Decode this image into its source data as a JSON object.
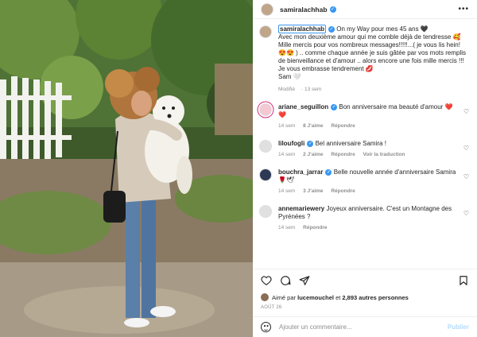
{
  "post": {
    "username": "samiralachhab",
    "more_label": "•••"
  },
  "caption": {
    "author": "samiralachhab",
    "lines": [
      "On my Way pour mes 45 ans 🖤",
      "Avec mon deuxième amour qui me comble déjà de tendresse 🥰",
      "Mille mercis pour vos nombreux messages!!!!!...( je vous lis hein! 😍😍 ) .. comme chaque année je suis gâtée par vos mots remplis de bienveillance et d'amour .. alors encore une fois mille mercis !!!",
      "Je vous embrasse tendrement 💋",
      "Sam 🤍"
    ],
    "edited": "Modifié",
    "time": "13 sem"
  },
  "comments": [
    {
      "username": "ariane_seguillon",
      "text": "Bon anniversaire ma beauté d'amour ❤️❤️",
      "time": "14 sem",
      "likes": "8 J'aime",
      "action": "Répondre"
    },
    {
      "username": "liloufogli",
      "text": "Bel anniversaire Samira !",
      "time": "14 sem",
      "likes": "2 J'aime",
      "action": "Répondre",
      "extra": "Voir la traduction"
    },
    {
      "username": "bouchra_jarrar",
      "text": "Belle nouvelle année d'anniversaire Samira 🌹🕊",
      "time": "14 sem",
      "likes": "3 J'aime",
      "action": "Répondre"
    },
    {
      "username": "annemariewery",
      "text": "Joyeux anniversaire. C'est un Montagne des Pyrénées ?",
      "time": "14 sem",
      "action": "Répondre"
    }
  ],
  "likes": {
    "prefix": "Aimé par",
    "user": "lucemouchel",
    "connector": "et",
    "others": "2,893 autres personnes"
  },
  "date": "AOÛT 26",
  "add_comment": {
    "placeholder": "Ajouter un commentaire...",
    "post_label": "Publier"
  },
  "colors": {
    "verified": "#3897f0",
    "publish_disabled": "#b3dbff"
  }
}
